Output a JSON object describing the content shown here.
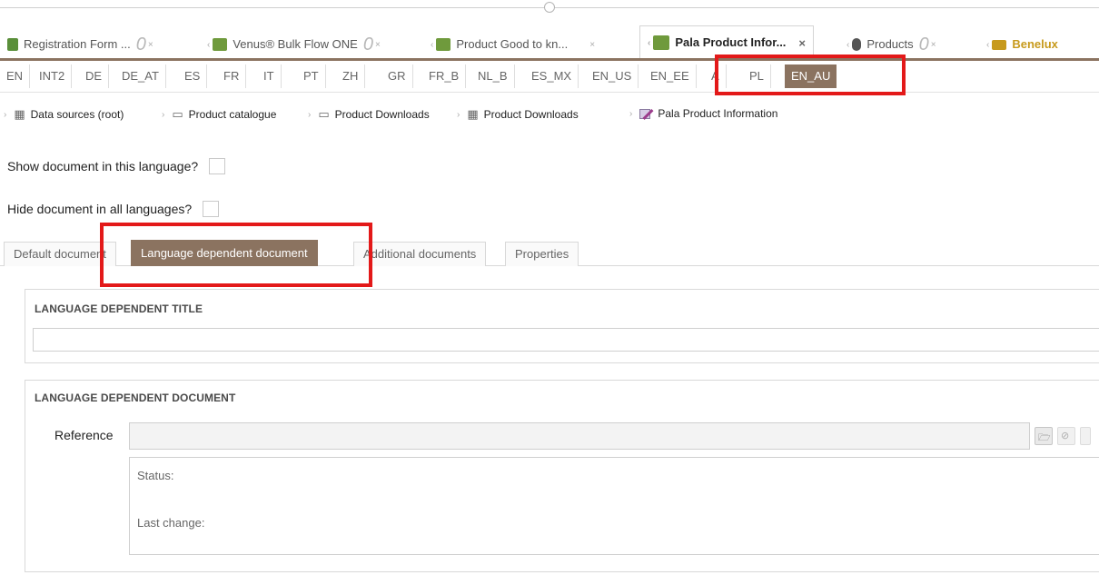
{
  "doc_tabs": [
    {
      "label": "Registration Form ...",
      "icon": "form-icon",
      "color": "#5a8f3a"
    },
    {
      "label": "Venus® Bulk Flow ONE",
      "icon": "table-icon",
      "color": "#6f9a3c"
    },
    {
      "label": "Product Good to kn...",
      "icon": "table-icon",
      "color": "#6f9a3c"
    },
    {
      "label": "Pala Product Infor...",
      "icon": "document-table-icon",
      "color": "#6f9a3c",
      "active": true
    },
    {
      "label": "Products",
      "icon": "database-icon",
      "color": "#555555"
    },
    {
      "label": "Benelux",
      "icon": "folder-icon",
      "color": "#c79a1c"
    }
  ],
  "languages": [
    "EN",
    "INT2",
    "DE",
    "DE_AT",
    "ES",
    "FR",
    "IT",
    "PT",
    "ZH",
    "GR",
    "FR_B",
    "NL_B",
    "ES_MX",
    "EN_US",
    "EN_EE",
    "A",
    "PL",
    "EN_AU"
  ],
  "selected_language": "EN_AU",
  "breadcrumb": [
    "Data sources (root)",
    "Product catalogue",
    "Product Downloads",
    "Product Downloads",
    "Pala Product Information"
  ],
  "show_in_language": {
    "label": "Show document in this language?",
    "checked": false
  },
  "hide_all_languages": {
    "label": "Hide document in all languages?",
    "checked": false
  },
  "content_tabs": [
    "Default document",
    "Language dependent document",
    "Additional documents",
    "Properties"
  ],
  "selected_content_tab": "Language dependent document",
  "title_panel": {
    "heading": "LANGUAGE DEPENDENT TITLE",
    "value": ""
  },
  "document_panel": {
    "heading": "LANGUAGE DEPENDENT DOCUMENT",
    "reference_label": "Reference",
    "reference_value": "",
    "status_label": "Status:",
    "last_change_label": "Last change:"
  },
  "colors": {
    "accent": "#8b7360",
    "highlight": "#e31919"
  }
}
